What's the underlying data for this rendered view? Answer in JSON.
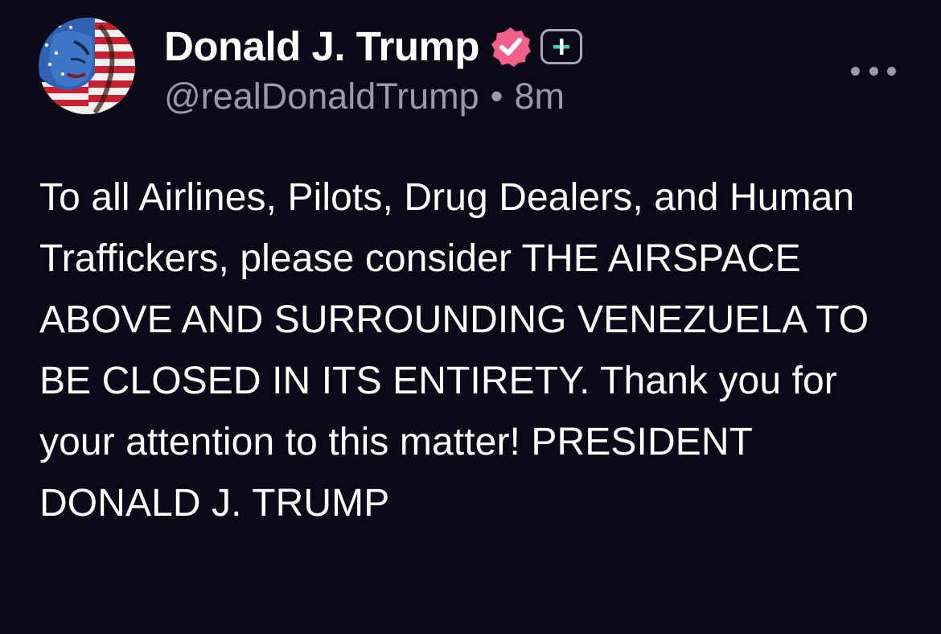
{
  "post": {
    "author": {
      "display_name": "Donald J. Trump",
      "handle": "@realDonaldTrump",
      "avatar_icon": "avatar-flag-face",
      "verified_icon": "verified-check-icon",
      "plus_icon": "plus-badge-icon"
    },
    "separator": "•",
    "timestamp": "8m",
    "more_icon": "more-horizontal-icon",
    "body": "To all Airlines, Pilots, Drug Dealers, and Human Traffickers, please consider THE AIRSPACE ABOVE AND SURROUNDING VENEZUELA TO BE CLOSED IN ITS ENTIRETY. Thank you for your attention to this matter! PRESIDENT DONALD J. TRUMP"
  },
  "colors": {
    "background": "#0b0918",
    "text": "#ffffff",
    "muted": "#9a98ab",
    "verified_badge": "#f25f8b",
    "plus_accent": "#33d6a6"
  }
}
